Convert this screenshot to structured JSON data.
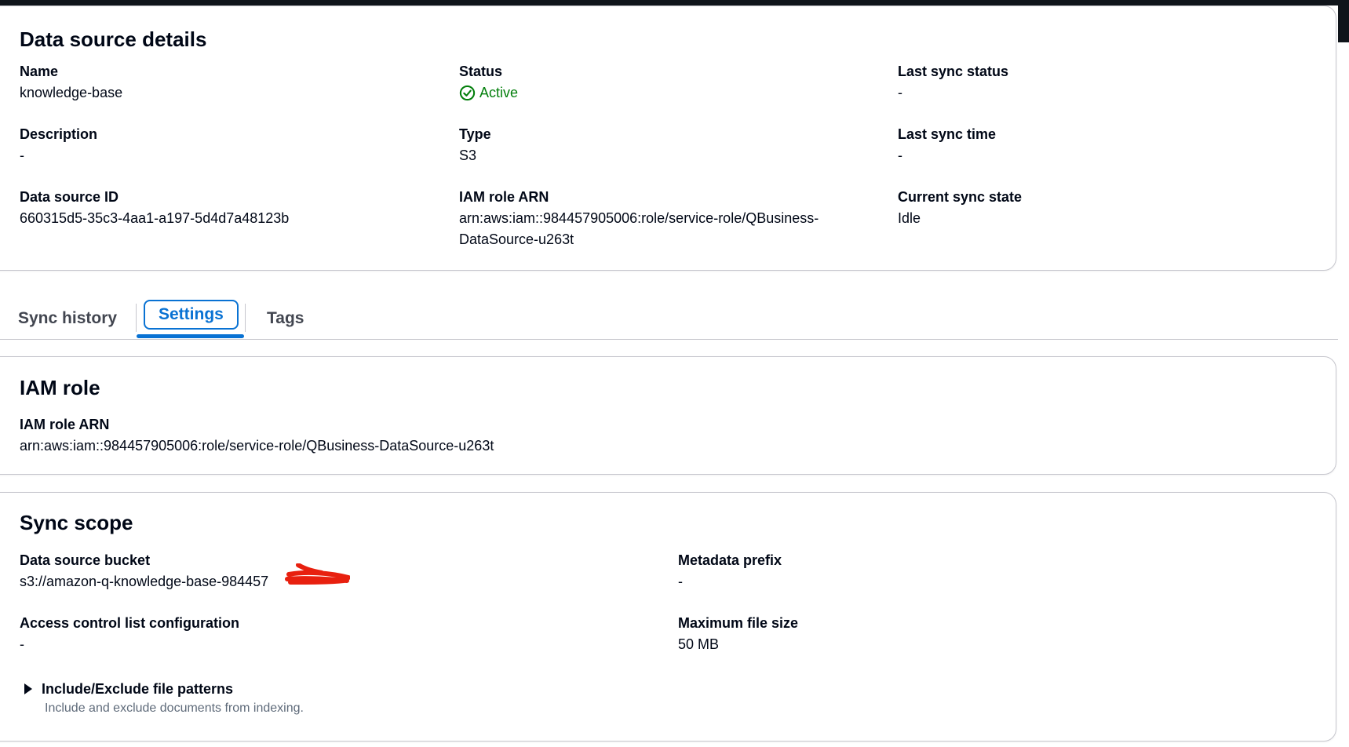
{
  "details": {
    "title": "Data source details",
    "name_label": "Name",
    "name_value": "knowledge-base",
    "status_label": "Status",
    "status_value": "Active",
    "last_sync_status_label": "Last sync status",
    "last_sync_status_value": "-",
    "description_label": "Description",
    "description_value": "-",
    "type_label": "Type",
    "type_value": "S3",
    "last_sync_time_label": "Last sync time",
    "last_sync_time_value": "-",
    "id_label": "Data source ID",
    "id_value": "660315d5-35c3-4aa1-a197-5d4d7a48123b",
    "iam_label": "IAM role ARN",
    "iam_value_line1": "arn:aws:iam::984457905006:role/service-role/QBusiness-",
    "iam_value_line2": "DataSource-u263t",
    "current_state_label": "Current sync state",
    "current_state_value": "Idle"
  },
  "tabs": [
    {
      "label": "Sync history"
    },
    {
      "label": "Settings"
    },
    {
      "label": "Tags"
    }
  ],
  "iam_role": {
    "title": "IAM role",
    "arn_label": "IAM role ARN",
    "arn_value": "arn:aws:iam::984457905006:role/service-role/QBusiness-DataSource-u263t"
  },
  "sync_scope": {
    "title": "Sync scope",
    "bucket_label": "Data source bucket",
    "bucket_value": "s3://amazon-q-knowledge-base-984457",
    "metadata_label": "Metadata prefix",
    "metadata_value": "-",
    "acl_label": "Access control list configuration",
    "acl_value": "-",
    "max_size_label": "Maximum file size",
    "max_size_value": "50 MB",
    "patterns_label": "Include/Exclude file patterns",
    "patterns_desc": "Include and exclude documents from indexing."
  },
  "colors": {
    "accent": "#0972d3",
    "success": "#037f0c",
    "text": "#000716",
    "tab_text": "#424650",
    "redaction": "#e8200f"
  }
}
